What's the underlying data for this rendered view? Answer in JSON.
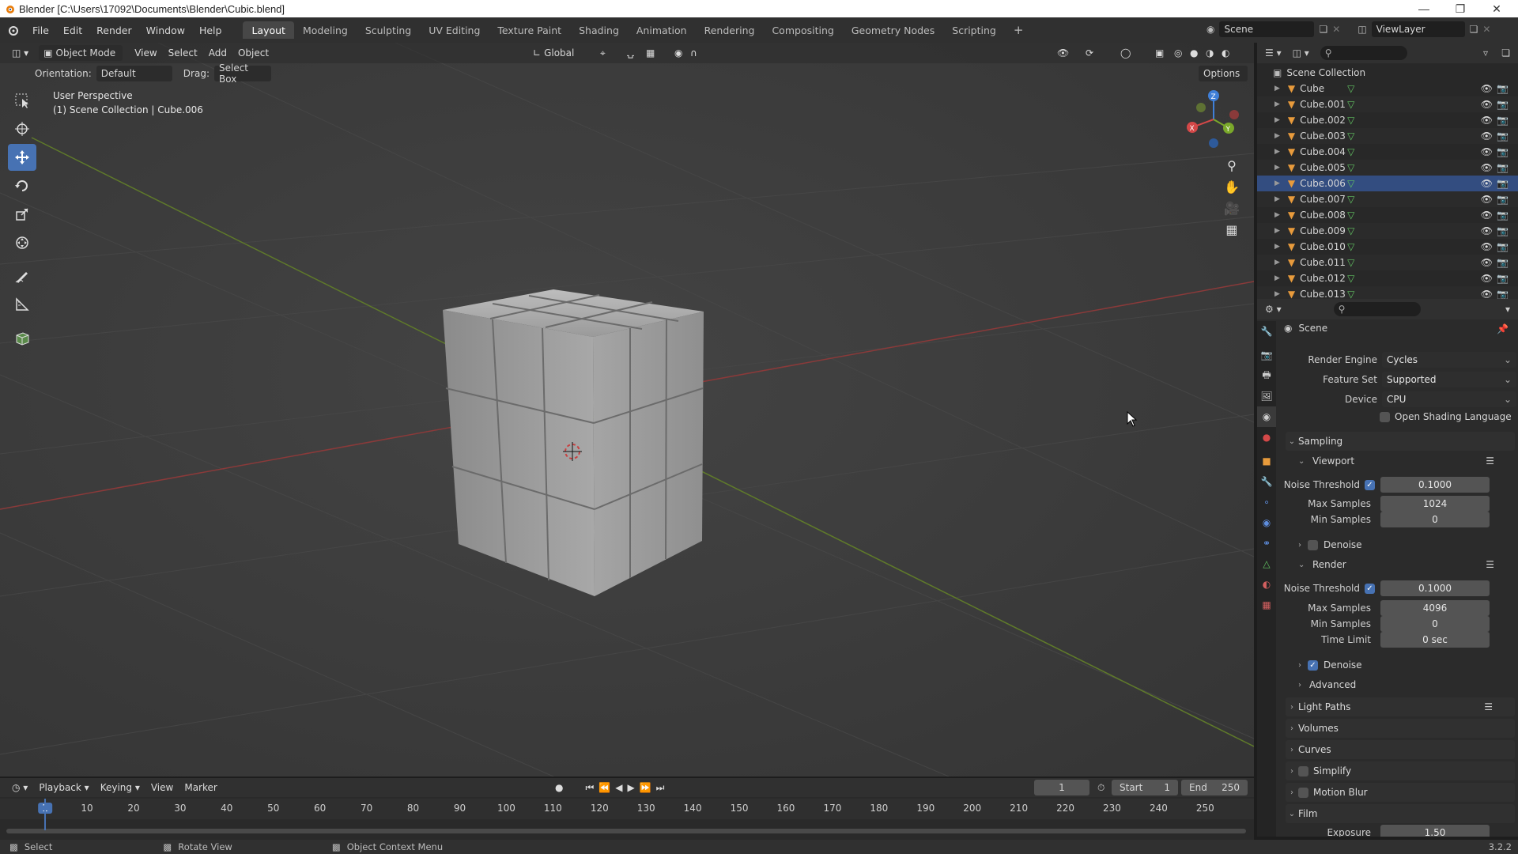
{
  "window": {
    "title": "Blender [C:\\Users\\17092\\Documents\\Blender\\Cubic.blend]"
  },
  "menu": [
    "File",
    "Edit",
    "Render",
    "Window",
    "Help"
  ],
  "workspaces": [
    "Layout",
    "Modeling",
    "Sculpting",
    "UV Editing",
    "Texture Paint",
    "Shading",
    "Animation",
    "Rendering",
    "Compositing",
    "Geometry Nodes",
    "Scripting"
  ],
  "topright": {
    "scene": "Scene",
    "viewlayer": "ViewLayer"
  },
  "viewport": {
    "mode": "Object Mode",
    "menus": [
      "View",
      "Select",
      "Add",
      "Object"
    ],
    "transform_orientation": "Global",
    "orientation_label": "Orientation:",
    "orientation_value": "Default",
    "drag_label": "Drag:",
    "drag_value": "Select Box",
    "options": "Options",
    "info_line1": "User Perspective",
    "info_line2": "(1) Scene Collection | Cube.006"
  },
  "outliner": {
    "root": "Scene Collection",
    "items": [
      "Cube",
      "Cube.001",
      "Cube.002",
      "Cube.003",
      "Cube.004",
      "Cube.005",
      "Cube.006",
      "Cube.007",
      "Cube.008",
      "Cube.009",
      "Cube.010",
      "Cube.011",
      "Cube.012",
      "Cube.013"
    ],
    "selected": "Cube.006"
  },
  "properties": {
    "context": "Scene",
    "render_engine_label": "Render Engine",
    "render_engine": "Cycles",
    "feature_set_label": "Feature Set",
    "feature_set": "Supported",
    "device_label": "Device",
    "device": "CPU",
    "osl_label": "Open Shading Language",
    "sampling": "Sampling",
    "viewport_panel": "Viewport",
    "render_panel": "Render",
    "noise_threshold_label": "Noise Threshold",
    "max_samples_label": "Max Samples",
    "min_samples_label": "Min Samples",
    "time_limit_label": "Time Limit",
    "viewport_noise_threshold": "0.1000",
    "viewport_max_samples": "1024",
    "viewport_min_samples": "0",
    "render_noise_threshold": "0.1000",
    "render_max_samples": "4096",
    "render_min_samples": "0",
    "render_time_limit": "0 sec",
    "denoise_label": "Denoise",
    "advanced": "Advanced",
    "light_paths": "Light Paths",
    "volumes": "Volumes",
    "curves": "Curves",
    "simplify": "Simplify",
    "motion_blur": "Motion Blur",
    "film": "Film",
    "exposure_label": "Exposure",
    "exposure": "1.50"
  },
  "timeline": {
    "menus": [
      "Playback",
      "Keying",
      "View",
      "Marker"
    ],
    "current_frame": "1",
    "start_label": "Start",
    "start": "1",
    "end_label": "End",
    "end": "250",
    "ticks": [
      "1",
      "10",
      "20",
      "30",
      "40",
      "50",
      "60",
      "70",
      "80",
      "90",
      "100",
      "110",
      "120",
      "130",
      "140",
      "150",
      "160",
      "170",
      "180",
      "190",
      "200",
      "210",
      "220",
      "230",
      "240",
      "250"
    ]
  },
  "status": {
    "select": "Select",
    "rotate": "Rotate View",
    "context": "Object Context Menu",
    "version": "3.2.2"
  }
}
